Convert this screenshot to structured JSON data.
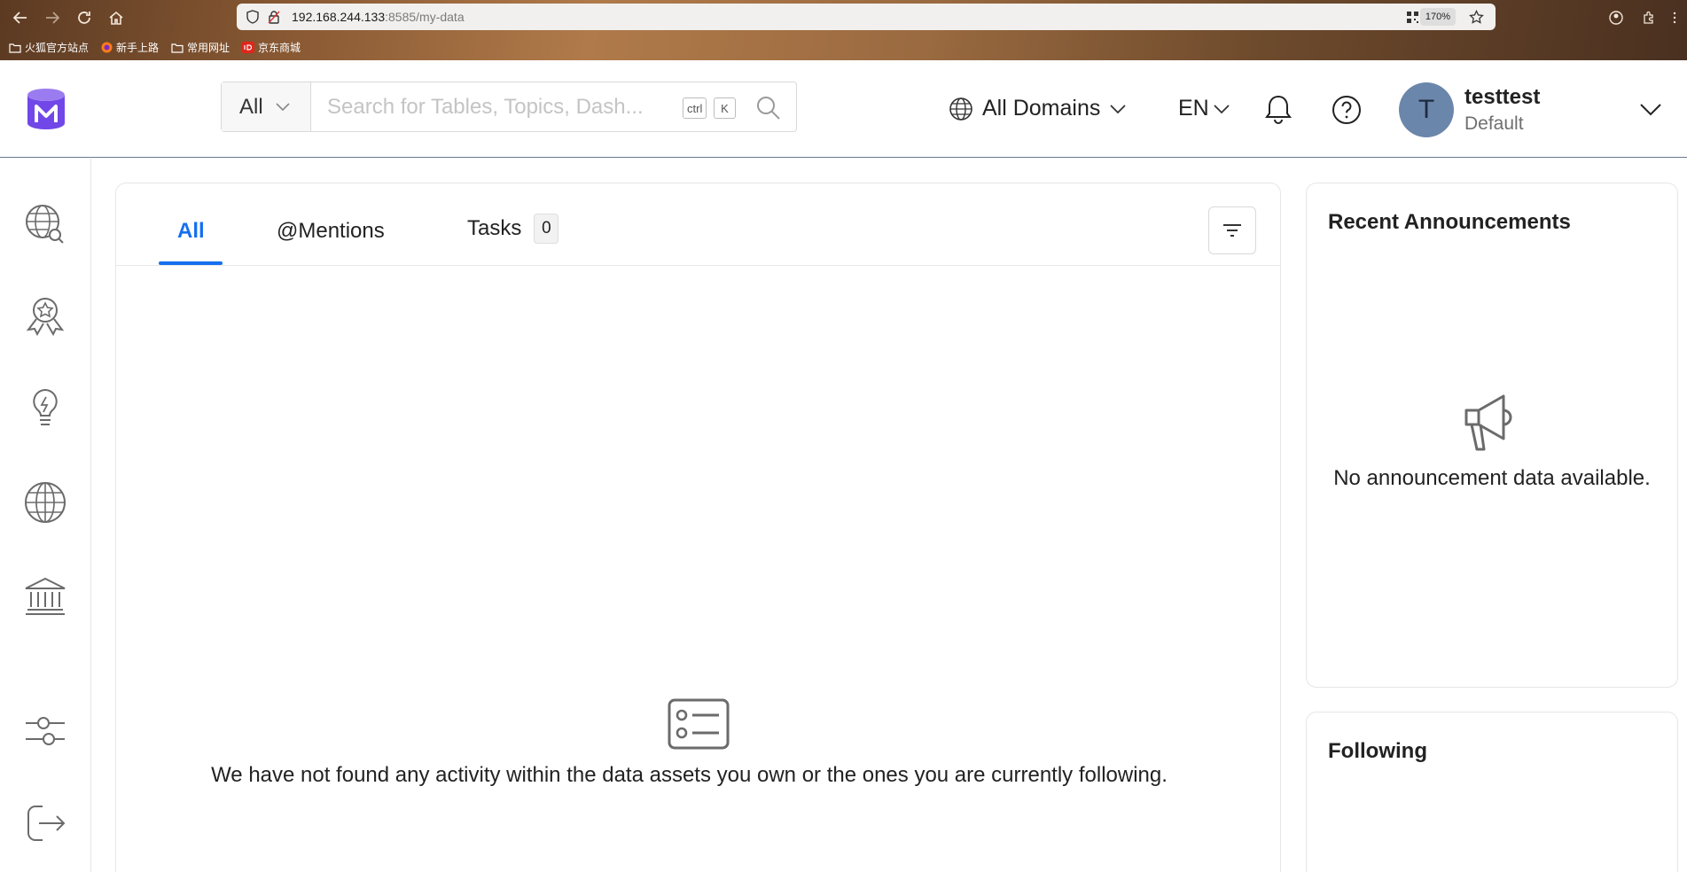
{
  "browser": {
    "url_host": "192.168.244.133",
    "url_path": ":8585/my-data",
    "zoom": "170%",
    "bookmarks": [
      "火狐官方站点",
      "新手上路",
      "常用网址",
      "京东商城"
    ]
  },
  "header": {
    "search_scope": "All",
    "search_placeholder": "Search for Tables, Topics, Dash...",
    "kbd_ctrl": "ctrl",
    "kbd_k": "K",
    "domain_label": "All Domains",
    "language": "EN",
    "user": {
      "initial": "T",
      "name": "testtest",
      "role": "Default"
    }
  },
  "sidebar": {
    "items": [
      "explore-icon",
      "data-quality-icon",
      "insights-icon",
      "domains-icon",
      "governance-icon",
      "settings-icon",
      "logout-icon"
    ]
  },
  "feed": {
    "tabs": [
      {
        "label": "All"
      },
      {
        "label": "@Mentions"
      },
      {
        "label": "Tasks",
        "count": "0"
      }
    ],
    "active_tab": "All",
    "empty_message": "We have not found any activity within the data assets you own or the ones you are currently following."
  },
  "announcements": {
    "title": "Recent Announcements",
    "empty_message": "No announcement data available."
  },
  "following": {
    "title": "Following"
  },
  "colors": {
    "accent": "#1570ef",
    "avatar_bg": "#6b86ab",
    "logo_purple": "#7147e8"
  }
}
